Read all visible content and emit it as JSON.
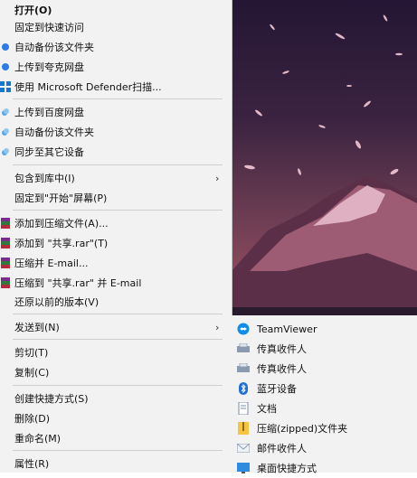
{
  "menu": {
    "items": [
      {
        "label": "打开(O)",
        "icon": "none"
      },
      {
        "label": "固定到快速访问",
        "icon": "none"
      },
      {
        "label": "自动备份该文件夹",
        "icon": "cloud-blue-icon"
      },
      {
        "label": "上传到夸克网盘",
        "icon": "cloud-blue-icon"
      },
      {
        "label": "使用 Microsoft Defender扫描...",
        "icon": "defender-shield-icon"
      },
      {
        "label": "上传到百度网盘",
        "icon": "baidu-cloud-icon"
      },
      {
        "label": "自动备份该文件夹",
        "icon": "baidu-cloud-icon"
      },
      {
        "label": "同步至其它设备",
        "icon": "baidu-cloud-icon"
      },
      {
        "label": "包含到库中(I)",
        "icon": "none",
        "arrow": "›"
      },
      {
        "label": "固定到\"开始\"屏幕(P)",
        "icon": "none"
      },
      {
        "label": "添加到压缩文件(A)...",
        "icon": "winrar-icon"
      },
      {
        "label": "添加到 \"共享.rar\"(T)",
        "icon": "winrar-icon"
      },
      {
        "label": "压缩并 E-mail...",
        "icon": "winrar-icon"
      },
      {
        "label": "压缩到 \"共享.rar\" 并 E-mail",
        "icon": "winrar-icon"
      },
      {
        "label": "还原以前的版本(V)",
        "icon": "none"
      },
      {
        "label": "发送到(N)",
        "icon": "none",
        "arrow": "›"
      },
      {
        "label": "剪切(T)",
        "icon": "none"
      },
      {
        "label": "复制(C)",
        "icon": "none"
      },
      {
        "label": "创建快捷方式(S)",
        "icon": "none"
      },
      {
        "label": "删除(D)",
        "icon": "none"
      },
      {
        "label": "重命名(M)",
        "icon": "none"
      },
      {
        "label": "属性(R)",
        "icon": "none"
      }
    ]
  },
  "sendto": {
    "items": [
      {
        "label": "TeamViewer",
        "icon": "teamviewer-icon"
      },
      {
        "label": "传真收件人",
        "icon": "fax-icon"
      },
      {
        "label": "传真收件人",
        "icon": "fax-icon"
      },
      {
        "label": "蓝牙设备",
        "icon": "bluetooth-icon"
      },
      {
        "label": "文档",
        "icon": "documents-icon"
      },
      {
        "label": "压缩(zipped)文件夹",
        "icon": "zip-folder-icon"
      },
      {
        "label": "邮件收件人",
        "icon": "mail-icon"
      },
      {
        "label": "桌面快捷方式",
        "icon": "desktop-icon"
      }
    ]
  }
}
